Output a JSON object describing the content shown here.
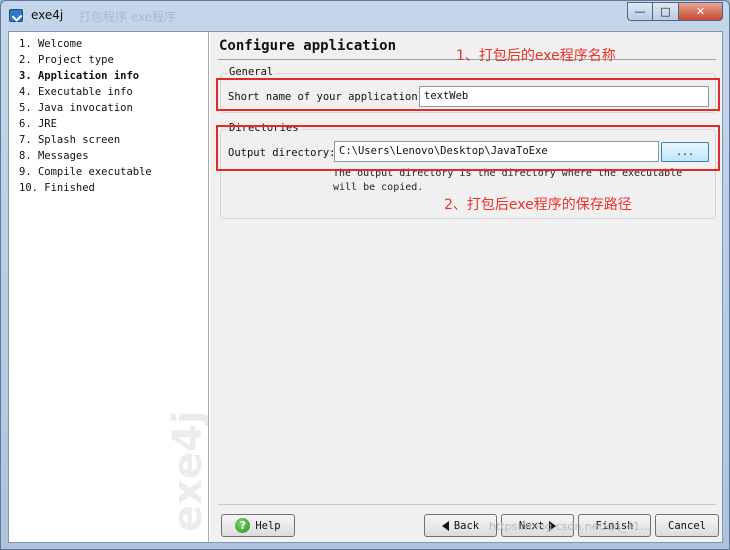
{
  "window": {
    "title": "exe4j",
    "title_ghost": "打包程序 exe程序",
    "minimize": "—",
    "maximize": "□",
    "close": "✕"
  },
  "sidebar": {
    "steps": [
      "1. Welcome",
      "2. Project type",
      "3. Application info",
      "4. Executable info",
      "5. Java invocation",
      "6. JRE",
      "7. Splash screen",
      "8. Messages",
      "9. Compile executable",
      "10. Finished"
    ],
    "active_index": 2,
    "watermark": "exe4j"
  },
  "main": {
    "heading": "Configure application",
    "general": {
      "title": "General",
      "short_name_label": "Short name of your application:",
      "short_name_value": "textWeb"
    },
    "directories": {
      "title": "Directories",
      "output_label": "Output directory:",
      "output_value": "C:\\Users\\Lenovo\\Desktop\\JavaToExe",
      "browse_label": "...",
      "help_text": "The output directory is the directory where the executable will be copied."
    },
    "annotations": {
      "note1": "1、打包后的exe程序名称",
      "note2": "2、打包后exe程序的保存路径",
      "color": "#e22a2a"
    }
  },
  "footer": {
    "help": "Help",
    "back": "Back",
    "next": "Next",
    "finish": "Finish",
    "cancel": "Cancel",
    "url_watermark": "https://blog.csdn.net/qq_41..."
  }
}
